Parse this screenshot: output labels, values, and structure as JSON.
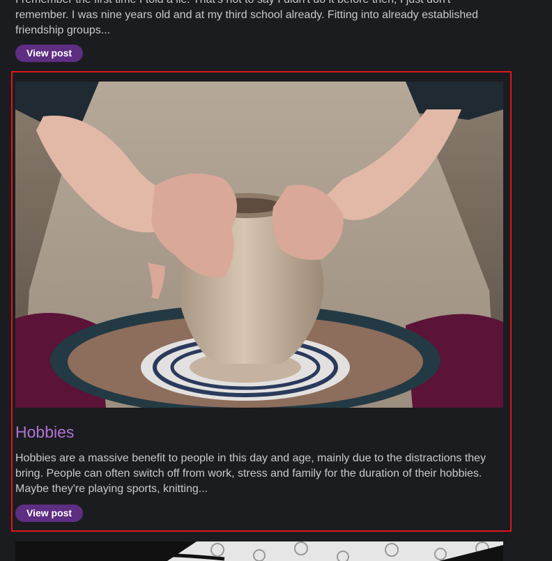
{
  "previous_post": {
    "excerpt": "I remember the first time I told a lie. That's not to say I didn't do it before then, I just don't remember. I was nine years old and at my third school already. Fitting into already established friendship groups...",
    "button_label": "View post"
  },
  "featured_post": {
    "image_icon": "pottery-wheel-photo",
    "title": "Hobbies",
    "excerpt": "Hobbies are a massive benefit to people in this day and age, mainly due to the distractions they bring. People can often switch off from work, stress and family for the duration of their hobbies. Maybe they're playing sports, knitting...",
    "button_label": "View post"
  },
  "next_post": {
    "image_icon": "jigsaw-puzzle-photo"
  },
  "colors": {
    "background": "#1b1c1f",
    "button": "#5e2e82",
    "title": "#b174d6",
    "highlight_border": "#e0161a"
  }
}
